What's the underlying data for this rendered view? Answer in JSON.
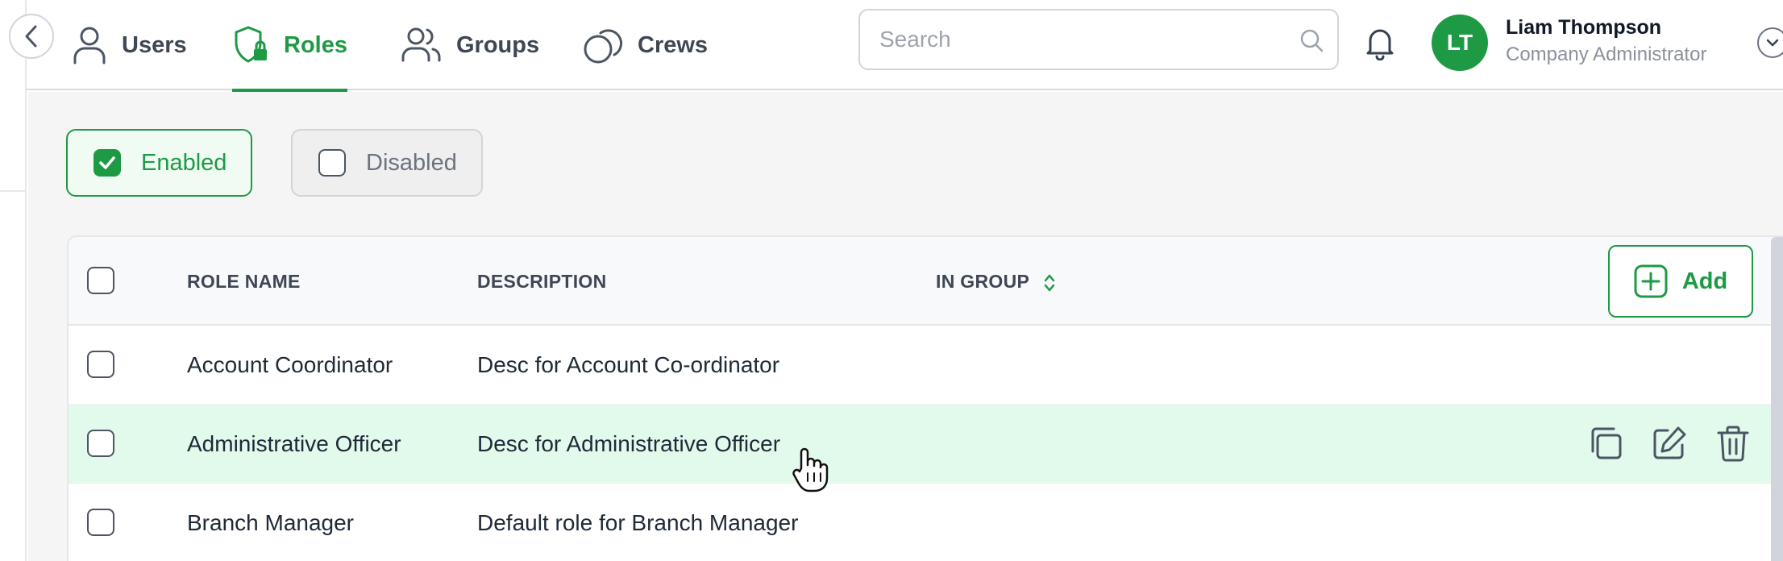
{
  "nav": {
    "back_icon": "chevron-left-icon",
    "tabs": [
      {
        "label": "Users",
        "icon": "user-icon",
        "active": false
      },
      {
        "label": "Roles",
        "icon": "shield-lock-icon",
        "active": true
      },
      {
        "label": "Groups",
        "icon": "users-icon",
        "active": false
      },
      {
        "label": "Crews",
        "icon": "crews-icon",
        "active": false
      }
    ]
  },
  "search": {
    "placeholder": "Search",
    "value": ""
  },
  "user": {
    "initials": "LT",
    "name": "Liam Thompson",
    "role": "Company Administrator"
  },
  "filters": {
    "enabled_label": "Enabled",
    "enabled_checked": true,
    "disabled_label": "Disabled",
    "disabled_checked": false
  },
  "table": {
    "columns": {
      "role_name": "ROLE NAME",
      "description": "DESCRIPTION",
      "in_group": "IN GROUP"
    },
    "add_label": "Add",
    "rows": [
      {
        "name": "Account Coordinator",
        "description": "Desc for Account Co-ordinator",
        "in_group": ""
      },
      {
        "name": "Administrative Officer",
        "description": "Desc for Administrative Officer",
        "in_group": ""
      },
      {
        "name": "Branch Manager",
        "description": "Default role for Branch Manager",
        "in_group": ""
      }
    ]
  },
  "colors": {
    "accent": "#1e9a45",
    "hover_row": "#e2faeb",
    "background": "#f5f5f5"
  }
}
